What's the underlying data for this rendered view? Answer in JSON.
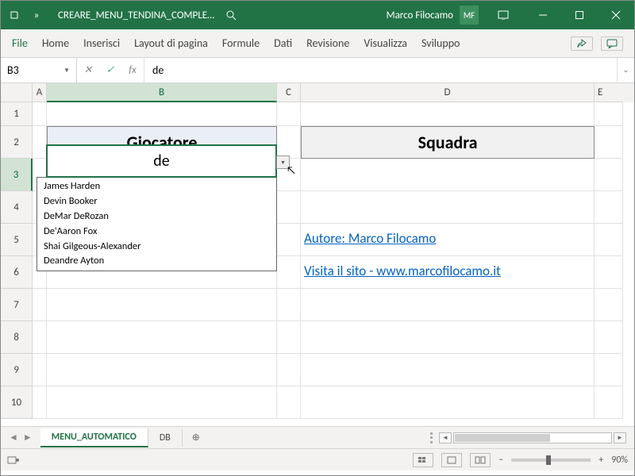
{
  "titlebar": {
    "filename": "CREARE_MENU_TENDINA_COMPLE…",
    "username": "Marco Filocamo",
    "initials": "MF"
  },
  "ribbon": {
    "tabs": [
      "File",
      "Home",
      "Inserisci",
      "Layout di pagina",
      "Formule",
      "Dati",
      "Revisione",
      "Visualizza",
      "Sviluppo"
    ]
  },
  "formula_bar": {
    "cell_ref": "B3",
    "value": "de"
  },
  "columns": [
    "A",
    "B",
    "C",
    "D",
    "E"
  ],
  "rows": [
    "1",
    "2",
    "3",
    "4",
    "5",
    "6",
    "7",
    "8",
    "9",
    "10"
  ],
  "headers": {
    "b2": "Giocatore",
    "d2": "Squadra"
  },
  "active_cell_value": "de",
  "dropdown_items": [
    "James Harden",
    "Devin Booker",
    "DeMar DeRozan",
    "De'Aaron Fox",
    "Shai Gilgeous-Alexander",
    "Deandre Ayton"
  ],
  "links": {
    "author": "Autore: Marco Filocamo",
    "site": "Visita il sito - www.marcofilocamo.it"
  },
  "sheets": {
    "active": "MENU_AUTOMATICO",
    "other": "DB"
  },
  "status": {
    "zoom": "90%"
  }
}
